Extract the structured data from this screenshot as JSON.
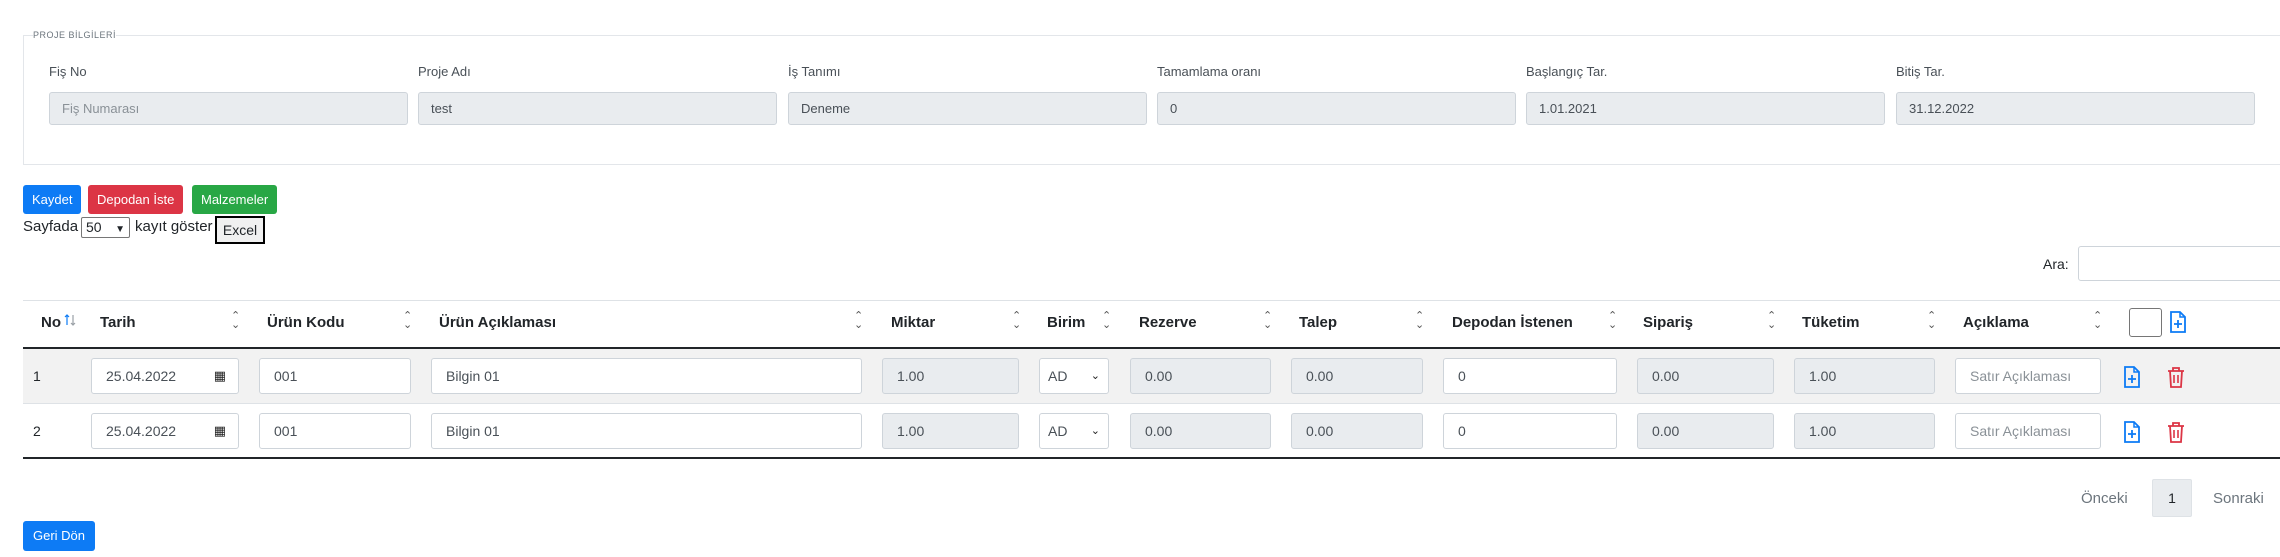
{
  "project": {
    "legend": "PROJE BİLGİLERİ",
    "fields": [
      {
        "label": "Fiş No",
        "value": "",
        "placeholder": "Fiş Numarası"
      },
      {
        "label": "Proje Adı",
        "value": "test",
        "placeholder": ""
      },
      {
        "label": "İş Tanımı",
        "value": "Deneme",
        "placeholder": ""
      },
      {
        "label": "Tamamlama oranı",
        "value": "0",
        "placeholder": ""
      },
      {
        "label": "Başlangıç Tar.",
        "value": "1.01.2021",
        "placeholder": ""
      },
      {
        "label": "Bitiş Tar.",
        "value": "31.12.2022",
        "placeholder": ""
      }
    ]
  },
  "toolbar": {
    "save_label": "Kaydet",
    "request_label": "Depodan İste",
    "materials_label": "Malzemeler",
    "excel_label": "Excel"
  },
  "length": {
    "prefix": "Sayfada",
    "value": "50",
    "suffix": "kayıt göster"
  },
  "search": {
    "label": "Ara:",
    "value": ""
  },
  "table": {
    "columns": [
      "No",
      "Tarih",
      "Ürün Kodu",
      "Ürün Açıklaması",
      "Miktar",
      "Birim",
      "Rezerve",
      "Talep",
      "Depodan İstenen",
      "Sipariş",
      "Tüketim",
      "Açıklama"
    ],
    "rows": [
      {
        "no": "1",
        "date": "25.04.2022",
        "code": "001",
        "desc": "Bilgin 01",
        "qty": "1.00",
        "unit": "AD",
        "reserve": "0.00",
        "request": "0.00",
        "from_depot": "0",
        "order": "0.00",
        "consumption": "1.00",
        "note_placeholder": "Satır Açıklaması"
      },
      {
        "no": "2",
        "date": "25.04.2022",
        "code": "001",
        "desc": "Bilgin 01",
        "qty": "1.00",
        "unit": "AD",
        "reserve": "0.00",
        "request": "0.00",
        "from_depot": "0",
        "order": "0.00",
        "consumption": "1.00",
        "note_placeholder": "Satır Açıklaması"
      }
    ]
  },
  "pagination": {
    "prev": "Önceki",
    "page": "1",
    "next": "Sonraki"
  },
  "back_label": "Geri Dön",
  "colors": {
    "primary": "#0d7bf5",
    "danger": "#dc3545",
    "success": "#28a745"
  }
}
